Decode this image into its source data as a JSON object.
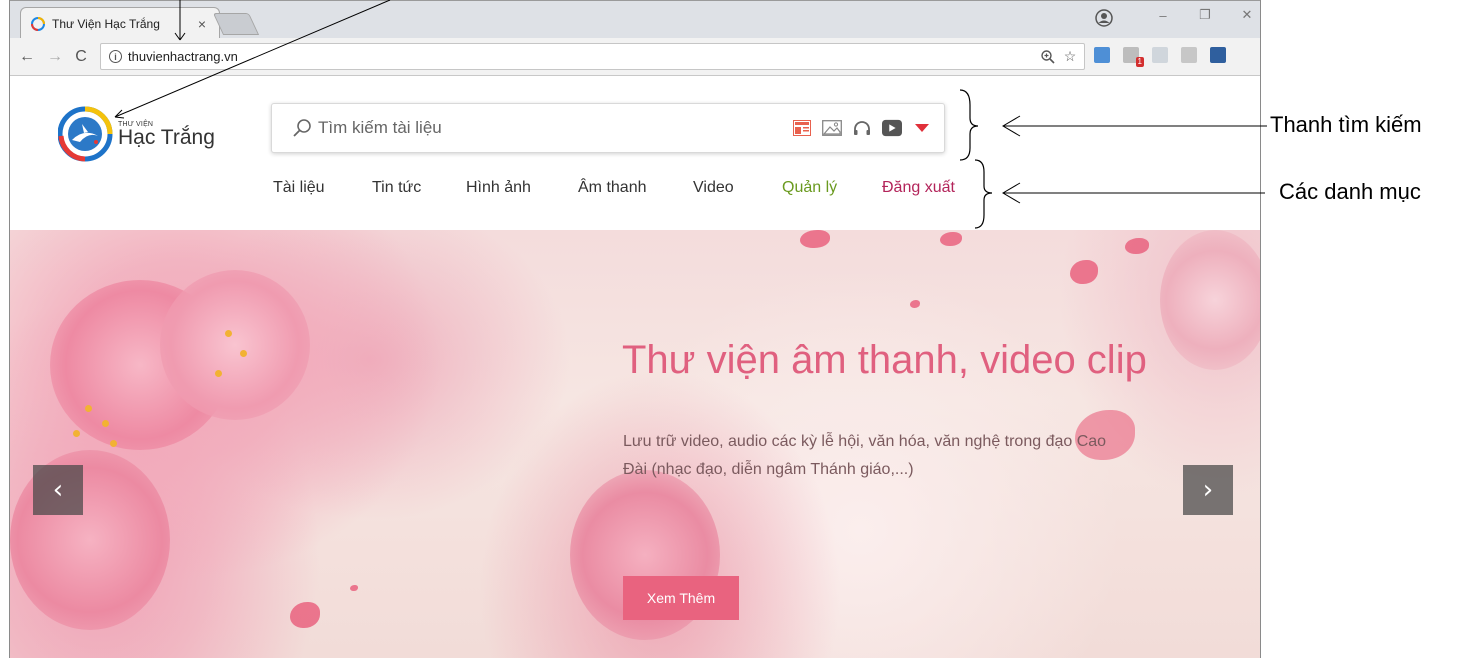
{
  "browser": {
    "tab_title": "Thư Viện Hạc Trắng",
    "tab_close": "×",
    "url": "thuvienhactrang.vn",
    "info_icon": "i",
    "zoom_icon": "zoom-icon",
    "bookmark_icon": "star-icon",
    "extension_badge": "1"
  },
  "site": {
    "logo": {
      "small_text": "THƯ VIỆN",
      "big_text": "Hạc Trắng"
    },
    "search": {
      "placeholder": "Tìm kiếm tài liệu",
      "type_icons": [
        "document-icon",
        "image-icon",
        "headphones-icon",
        "video-icon",
        "chevron-down-icon"
      ]
    },
    "nav": [
      {
        "label": "Tài liệu",
        "color": "#333333"
      },
      {
        "label": "Tin tức",
        "color": "#333333"
      },
      {
        "label": "Hình ảnh",
        "color": "#333333"
      },
      {
        "label": "Âm thanh",
        "color": "#333333"
      },
      {
        "label": "Video",
        "color": "#333333"
      },
      {
        "label": "Quản lý",
        "color": "#6a9a1f"
      },
      {
        "label": "Đăng xuất",
        "color": "#b3245a"
      }
    ],
    "hero": {
      "title": "Thư viện âm thanh, video clip",
      "description": "Lưu trữ video, audio các kỳ lễ hội, văn hóa, văn nghệ trong đạo Cao Đài (nhạc đạo, diễn ngâm Thánh giáo,...)",
      "button_label": "Xem Thêm",
      "prev_arrow": "‹",
      "next_arrow": "›"
    }
  },
  "annotations": {
    "search_bar": "Thanh tìm kiếm",
    "categories": "Các danh mục"
  },
  "colors": {
    "accent_pink": "#e9637f",
    "hero_title": "#e0607f",
    "manage": "#6a9a1f",
    "logout": "#b3245a"
  }
}
